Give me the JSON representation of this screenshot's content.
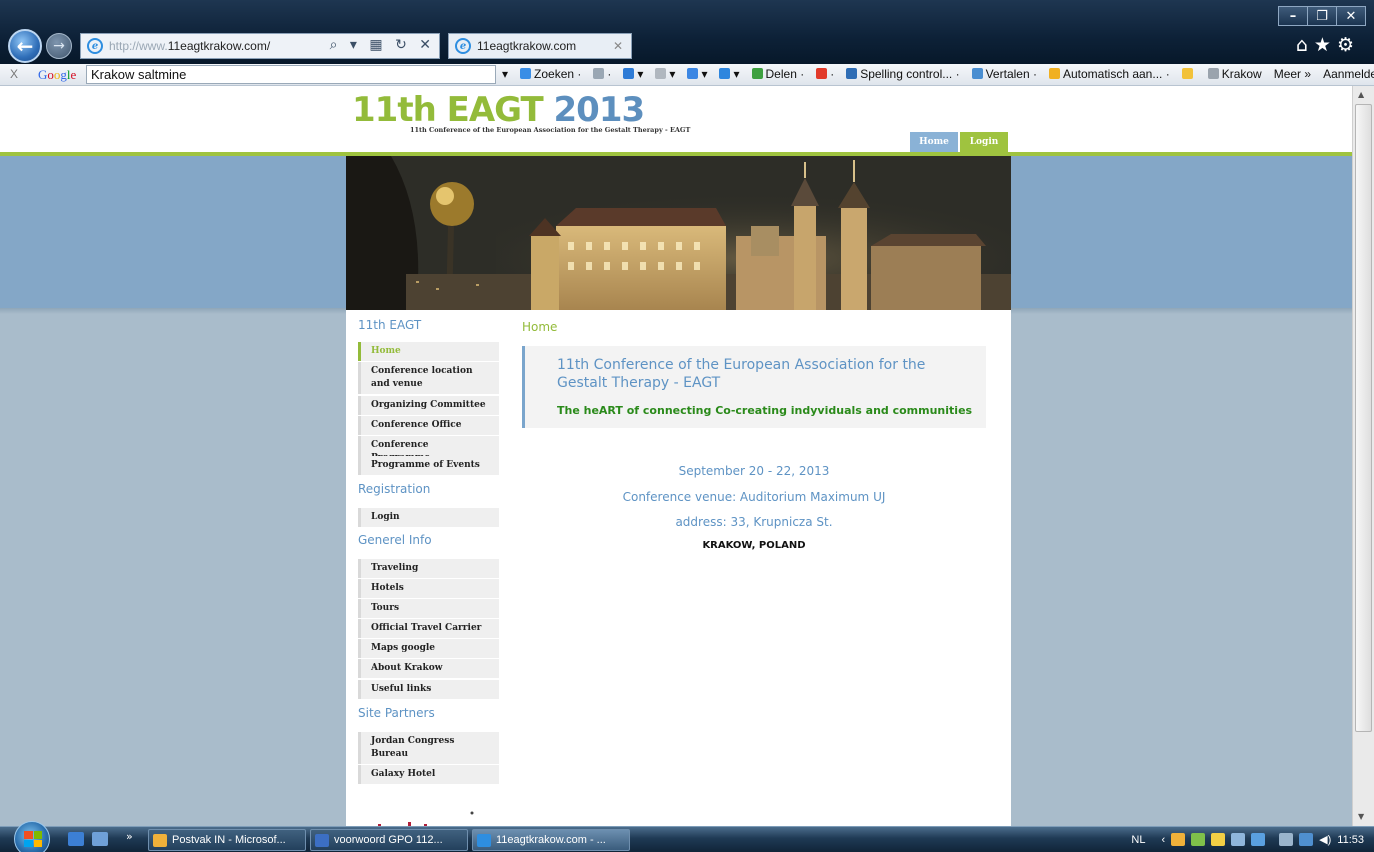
{
  "browser": {
    "url_prefix": "http://www.",
    "url_main": "11eagtkrakow.com/",
    "tab_title": "11eagtkrakow.com",
    "addr_tools": "⌕ ▾ ▦ ↻ ✕",
    "window_controls": [
      "–",
      "❐",
      "✕"
    ]
  },
  "google_toolbar": {
    "close": "X",
    "logo": "Google",
    "search_value": "Krakow saltmine",
    "items": [
      {
        "label": "▾",
        "color": ""
      },
      {
        "label": "Zoeken ·",
        "color": "#3a8ee6"
      },
      {
        "label": "·",
        "color": "#9aa7b4"
      },
      {
        "label": "▾",
        "color": "#2e7bd6"
      },
      {
        "label": "▾",
        "color": "#b0b7bf"
      },
      {
        "label": "▾",
        "color": "#3b86e3"
      },
      {
        "label": "▾",
        "color": "#2e86de"
      },
      {
        "label": "Delen ·",
        "color": "#3ea040"
      },
      {
        "label": "·",
        "color": "#e23a2a"
      },
      {
        "label": "Spelling control... ·",
        "color": "#2f6db5"
      },
      {
        "label": "Vertalen ·",
        "color": "#4a8ed1"
      },
      {
        "label": "Automatisch aan... ·",
        "color": "#f0b022"
      },
      {
        "label": "",
        "color": "#f2c23a"
      },
      {
        "label": "Krakow",
        "color": "#9aa3ad"
      },
      {
        "label": "Meer »",
        "color": ""
      },
      {
        "label": "Aanmelden",
        "color": ""
      },
      {
        "label": "🔧 ·",
        "color": ""
      }
    ]
  },
  "site": {
    "logo_title": "11th EAGT",
    "logo_year": "2013",
    "logo_subtitle": "11th Conference of the European Association for the Gestalt Therapy - EAGT",
    "nav": {
      "home": "Home",
      "login": "Login"
    }
  },
  "sidebar": {
    "sections": [
      {
        "heading": "11th EAGT",
        "items": [
          {
            "label": "Home",
            "active": true
          },
          {
            "label": "Conference location and venue"
          },
          {
            "label": "Organizing Committee"
          },
          {
            "label": "Conference Office"
          },
          {
            "label": "Conference Programme"
          },
          {
            "label": "Programme of Events"
          }
        ]
      },
      {
        "heading": "Registration",
        "items": [
          {
            "label": "Login"
          }
        ]
      },
      {
        "heading": "Generel Info",
        "items": [
          {
            "label": "Traveling"
          },
          {
            "label": "Hotels"
          },
          {
            "label": "Tours"
          },
          {
            "label": "Official Travel Carrier"
          },
          {
            "label": "Maps google"
          },
          {
            "label": "About Krakow"
          },
          {
            "label": "Useful links"
          }
        ]
      },
      {
        "heading": "Site Partners",
        "items": [
          {
            "label": "Jordan Congress Bureau"
          },
          {
            "label": "Galaxy Hotel"
          }
        ]
      }
    ]
  },
  "main": {
    "breadcrumb": "Home",
    "intro_title": "11th Conference of the European Association for the Gestalt Therapy - EAGT",
    "intro_subtitle": "The heART of connecting Co-creating indyviduals and communities",
    "dates": "September 20 - 22, 2013",
    "venue": "Conference venue: Auditorium Maximum UJ",
    "address": "address: 33, Krupnicza St.",
    "city": "KRAKOW, POLAND"
  },
  "taskbar": {
    "chevron": "»",
    "tasks": [
      {
        "label": "Postvak IN - Microsof...",
        "color": "#f0b13a"
      },
      {
        "label": "voorwoord GPO 112...",
        "color": "#3c6fc4"
      },
      {
        "label": "11eagtkrakow.com - ...",
        "color": "#2e8ee0"
      }
    ],
    "lang": "NL",
    "tray_arrow": "‹",
    "clock": "11:53"
  },
  "colors": {
    "green": "#93bb3a",
    "blue": "#5e93c4",
    "band": "#84a7c7",
    "page_bg": "#a9bccb"
  }
}
